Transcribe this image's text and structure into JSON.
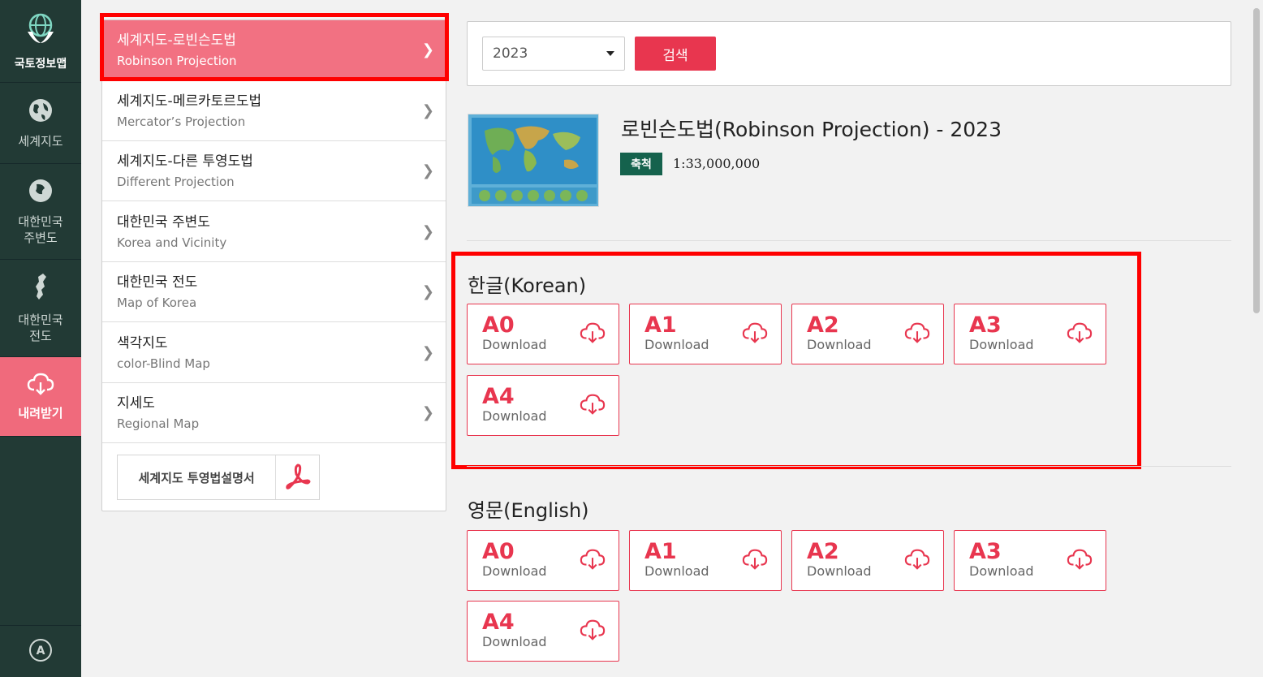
{
  "sidebar": {
    "logo_label": "국토정보맵",
    "items": [
      {
        "label": "세계지도"
      },
      {
        "label": "대한민국 주변도"
      },
      {
        "label": "대한민국 전도"
      },
      {
        "label": "내려받기"
      }
    ],
    "active_color": "#f06a7c"
  },
  "menu": {
    "items": [
      {
        "ko": "세계지도-로빈슨도법",
        "en": "Robinson Projection"
      },
      {
        "ko": "세계지도-메르카토르도법",
        "en": "Mercator’s Projection"
      },
      {
        "ko": "세계지도-다른 투영도법",
        "en": "Different Projection"
      },
      {
        "ko": "대한민국 주변도",
        "en": "Korea and Vicinity"
      },
      {
        "ko": "대한민국 전도",
        "en": "Map of Korea"
      },
      {
        "ko": "색각지도",
        "en": "color-Blind Map"
      },
      {
        "ko": "지세도",
        "en": "Regional Map"
      }
    ],
    "pdf_button_label": "세계지도 투영법설명서"
  },
  "search": {
    "year": "2023",
    "button_label": "검색"
  },
  "map": {
    "title": "로빈슨도법(Robinson Projection) - 2023",
    "scale_label": "축척",
    "scale_value": "1:33,000,000"
  },
  "sections": {
    "korean": {
      "title": "한글(Korean)",
      "buttons": [
        {
          "size": "A0",
          "label": "Download"
        },
        {
          "size": "A1",
          "label": "Download"
        },
        {
          "size": "A2",
          "label": "Download"
        },
        {
          "size": "A3",
          "label": "Download"
        },
        {
          "size": "A4",
          "label": "Download"
        }
      ]
    },
    "english": {
      "title": "영문(English)",
      "buttons": [
        {
          "size": "A0",
          "label": "Download"
        },
        {
          "size": "A1",
          "label": "Download"
        },
        {
          "size": "A2",
          "label": "Download"
        },
        {
          "size": "A3",
          "label": "Download"
        },
        {
          "size": "A4",
          "label": "Download"
        }
      ]
    }
  },
  "colors": {
    "accent": "#e8364f",
    "sidebar_bg": "#223a35",
    "highlight": "#ff0000",
    "scale_badge": "#15624d"
  }
}
